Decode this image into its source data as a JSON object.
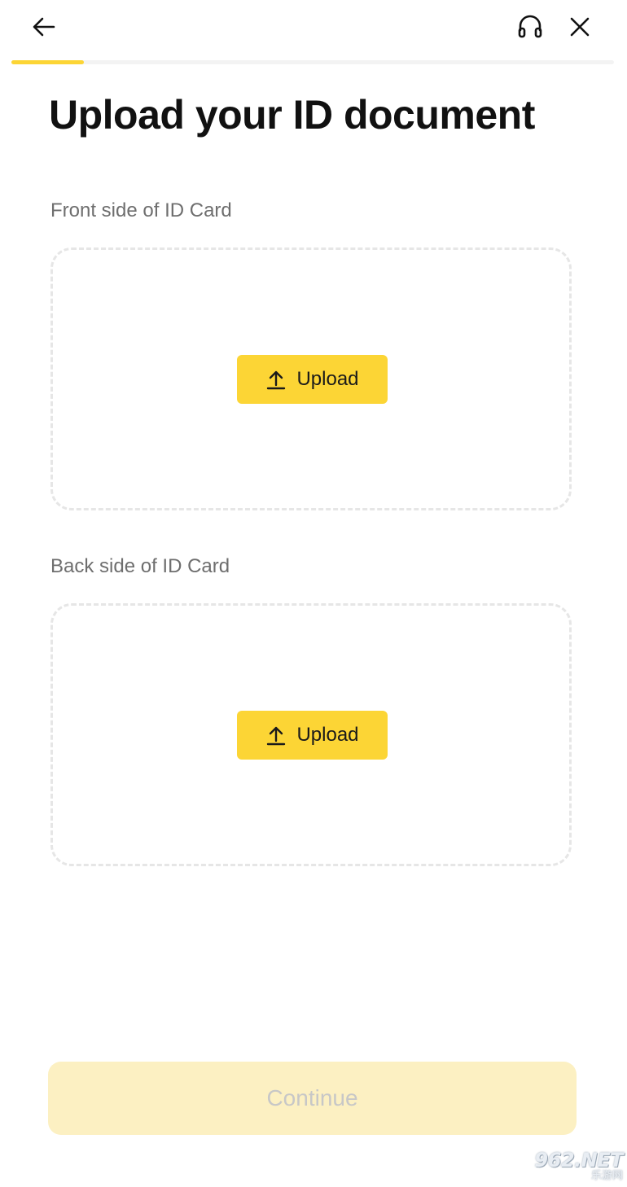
{
  "header": {
    "back_icon": "arrow-left-icon",
    "support_icon": "headset-icon",
    "close_icon": "close-icon"
  },
  "progress": {
    "fraction": 0.12,
    "color": "#fcd535"
  },
  "page": {
    "title": "Upload your ID document"
  },
  "sections": [
    {
      "label": "Front side of ID Card",
      "button_label": "Upload",
      "button_icon": "upload-arrow-icon"
    },
    {
      "label": "Back side of ID Card",
      "button_label": "Upload",
      "button_icon": "upload-arrow-icon"
    }
  ],
  "footer": {
    "continue_label": "Continue",
    "continue_enabled": false
  },
  "watermark": {
    "main": "962.NET",
    "sub": "乐游网"
  },
  "colors": {
    "accent": "#fcd535",
    "accent_disabled": "#fcf0c2",
    "text_primary": "#111111",
    "text_secondary": "#6e6e6e",
    "dashed_border": "#e6e6e6"
  }
}
